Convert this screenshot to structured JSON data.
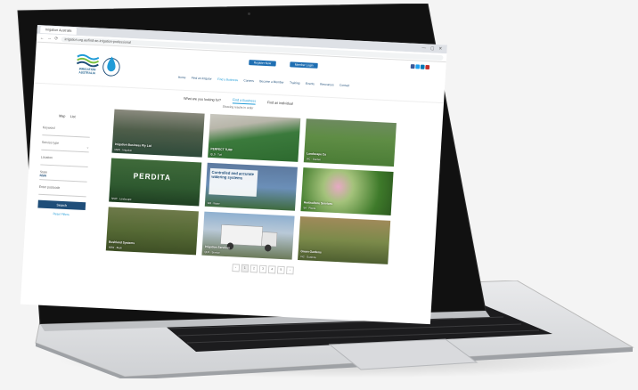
{
  "browser": {
    "tab_title": "Irrigation Australia",
    "address": "irrigation.org.au/find-an-irrigation-professional",
    "window_controls": "— ▢ ✕",
    "back": "←",
    "forward": "→",
    "reload": "⟳"
  },
  "header": {
    "logo_text": "IRRIGATION AUSTRALIA",
    "btn_register": "Register Now",
    "btn_member": "Member Login",
    "nav": [
      "Home",
      "Find an Irrigator",
      "Find a Business",
      "Careers",
      "Become a Member",
      "Training",
      "Events",
      "Resources",
      "Contact"
    ]
  },
  "finder": {
    "question": "What are you looking for?",
    "tab_business": "Find a Business",
    "tab_individual": "Find an Individual",
    "results_line": "Showing results in order"
  },
  "sidebar": {
    "toggle_map": "Map",
    "toggle_list": "List",
    "field_keyword": "Keyword",
    "field_service": "Service type",
    "field_location": "Location",
    "field_state": "State",
    "state_value": "NSW",
    "field_postcode": "Enter postcode",
    "search_label": "Search",
    "reset_label": "Reset Filters"
  },
  "cards": [
    {
      "caption": "Irrigation Business Pty Ltd",
      "meta": "NSW · Irrigation"
    },
    {
      "caption": "PERFECT TURF",
      "meta": "QLD · Turf"
    },
    {
      "caption": "Landscape Co",
      "meta": "VIC · Garden"
    },
    {
      "caption": "PERDITA",
      "meta": "NSW · Landscape"
    },
    {
      "caption": "Controlled and accurate watering systems",
      "meta": "WA · Water"
    },
    {
      "caption": "Horticulture Services",
      "meta": "SA · Plants"
    },
    {
      "caption": "Bushland Systems",
      "meta": "NSW · Bush"
    },
    {
      "caption": "Irrigation Services",
      "meta": "QLD · Service"
    },
    {
      "caption": "Green Gardens",
      "meta": "VIC · Gardens"
    }
  ],
  "pager": [
    "‹",
    "1",
    "2",
    "3",
    "4",
    "5",
    "›"
  ]
}
